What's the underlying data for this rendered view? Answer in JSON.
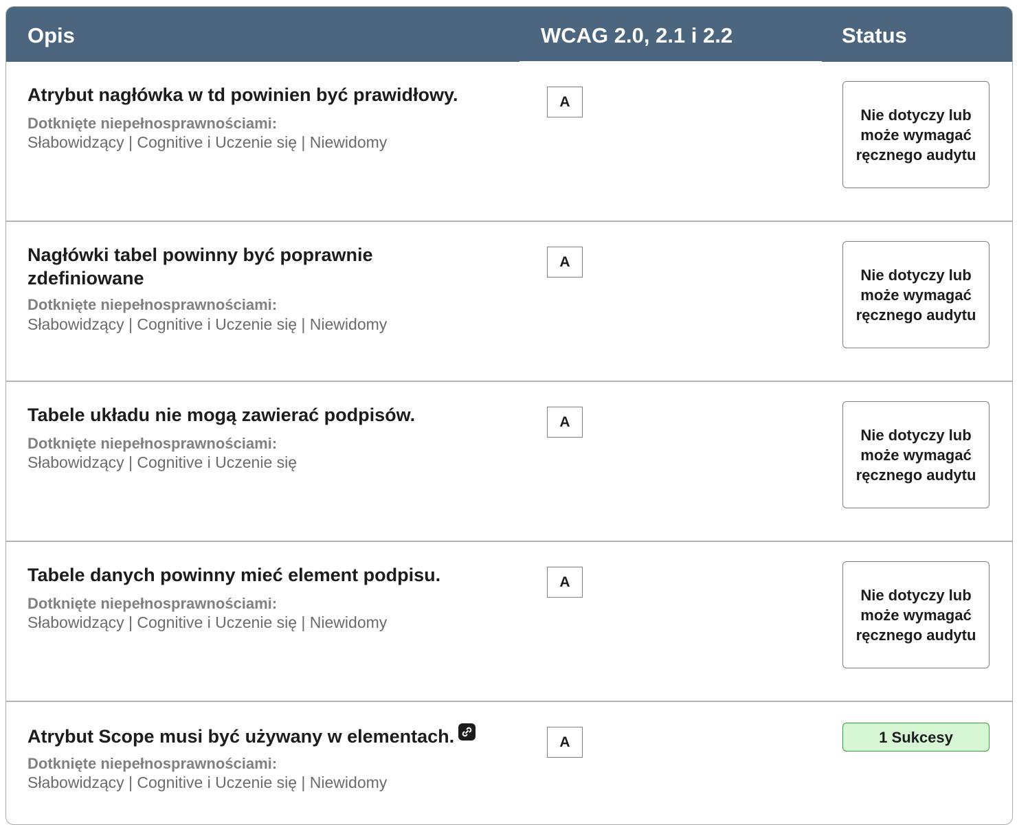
{
  "headers": {
    "opis": "Opis",
    "wcag": "WCAG 2.0, 2.1 i 2.2",
    "status": "Status"
  },
  "rows": [
    {
      "title": "Atrybut nagłówka w td powinien być prawidłowy.",
      "affected_label": "Dotknięte niepełnosprawnościami:",
      "affected_value": "Słabowidzący | Cognitive i Uczenie się | Niewidomy",
      "level": "A",
      "status": "Nie dotyczy lub może wymagać ręcznego audytu"
    },
    {
      "title": "Nagłówki tabel powinny być poprawnie zdefiniowane",
      "affected_label": "Dotknięte niepełnosprawnościami:",
      "affected_value": "Słabowidzący | Cognitive i Uczenie się | Niewidomy",
      "level": "A",
      "status": "Nie dotyczy lub może wymagać ręcznego audytu"
    },
    {
      "title": "Tabele układu nie mogą zawierać podpisów.",
      "affected_label": "Dotknięte niepełnosprawnościami:",
      "affected_value": "Słabowidzący | Cognitive i Uczenie się",
      "level": "A",
      "status": "Nie dotyczy lub może wymagać ręcznego audytu"
    },
    {
      "title": "Tabele danych powinny mieć element podpisu.",
      "affected_label": "Dotknięte niepełnosprawnościami:",
      "affected_value": "Słabowidzący | Cognitive i Uczenie się | Niewidomy",
      "level": "A",
      "status": "Nie dotyczy lub może wymagać ręcznego audytu"
    },
    {
      "title": "Atrybut Scope musi być używany w elementach.",
      "affected_label": "Dotknięte niepełnosprawnościami:",
      "affected_value": "Słabowidzący | Cognitive i Uczenie się | Niewidomy",
      "level": "A",
      "status": "1 Sukcesy",
      "icon": "link-icon"
    }
  ],
  "colors": {
    "header_bg": "#4d6680",
    "success_bg": "#d6f7d4",
    "success_border": "#3c9c3c"
  }
}
